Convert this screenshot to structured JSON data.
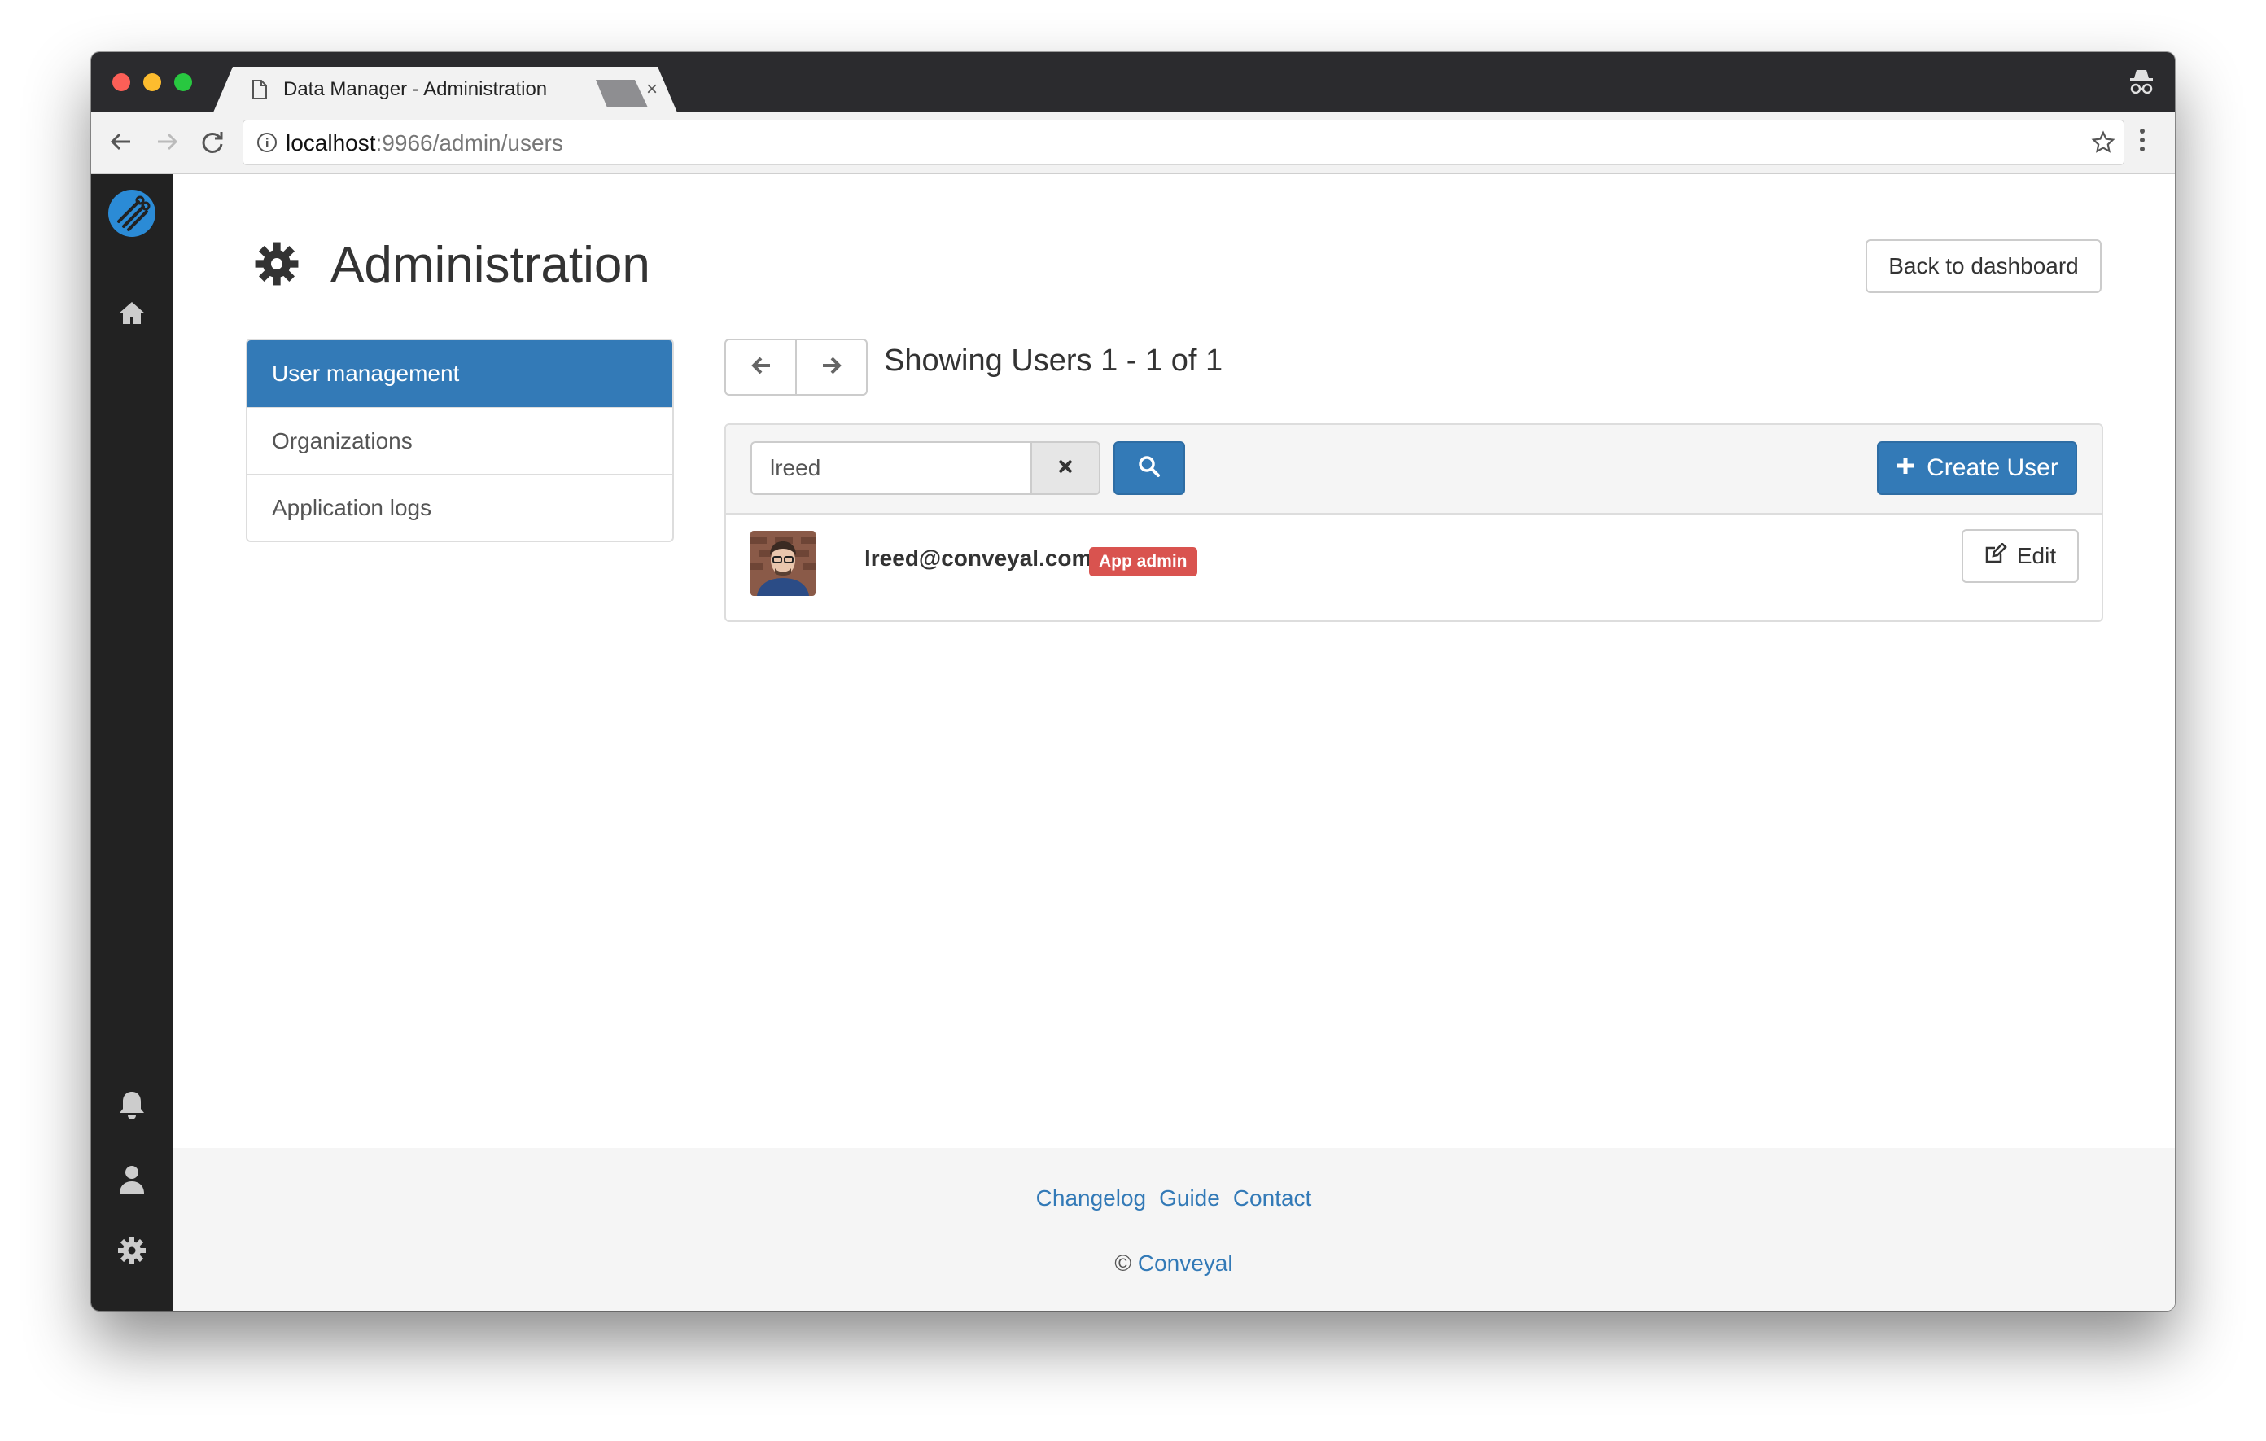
{
  "browser": {
    "tab_title": "Data Manager - Administration",
    "tab_close": "×",
    "url_host": "localhost",
    "url_path": ":9966/admin/users"
  },
  "page": {
    "title": "Administration",
    "back_button": "Back to dashboard"
  },
  "admin_nav": {
    "items": [
      {
        "label": "User management",
        "active": true
      },
      {
        "label": "Organizations",
        "active": false
      },
      {
        "label": "Application logs",
        "active": false
      }
    ]
  },
  "pagination": {
    "showing_text": "Showing Users 1 - 1 of 1"
  },
  "search": {
    "value": "lreed"
  },
  "create_user_label": "Create User",
  "users": [
    {
      "email": "lreed@conveyal.com",
      "badge": "App admin",
      "edit_label": "Edit"
    }
  ],
  "footer": {
    "links": [
      "Changelog",
      "Guide",
      "Contact"
    ],
    "copyright_symbol": "©",
    "company": "Conveyal"
  },
  "colors": {
    "primary": "#337ab7",
    "danger_badge": "#d9534f",
    "sidebar_bg": "#222222",
    "footer_bg": "#f5f5f5"
  },
  "icons": {
    "sidebar": [
      "conveyal-logo-icon",
      "home-icon",
      "bell-icon",
      "user-icon",
      "cog-icon"
    ],
    "title": "cog-icon",
    "pager": [
      "arrow-left-icon",
      "arrow-right-icon"
    ],
    "search": [
      "clear-x-icon",
      "search-icon"
    ],
    "create": "plus-icon",
    "edit": "edit-icon"
  }
}
